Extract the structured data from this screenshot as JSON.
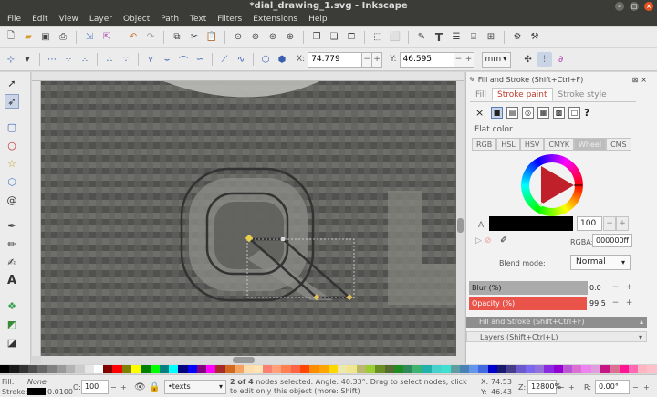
{
  "window": {
    "title": "*dial_drawing_1.svg - Inkscape"
  },
  "menu": [
    "File",
    "Edit",
    "View",
    "Layer",
    "Object",
    "Path",
    "Text",
    "Filters",
    "Extensions",
    "Help"
  ],
  "toolbar": {
    "x_label": "X:",
    "x_value": "74.779",
    "y_label": "Y:",
    "y_value": "46.595",
    "unit": "mm"
  },
  "fill_stroke": {
    "header": "Fill and Stroke (Shift+Ctrl+F)",
    "tabs": [
      "Fill",
      "Stroke paint",
      "Stroke style"
    ],
    "active_tab": "Stroke paint",
    "flat_color_label": "Flat color",
    "color_modes": [
      "RGB",
      "HSL",
      "HSV",
      "CMYK",
      "Wheel",
      "CMS"
    ],
    "active_mode": "Wheel",
    "alpha_label": "A:",
    "alpha_value": "100",
    "rgba_label": "RGBA:",
    "rgba_value": "000000ff",
    "blend_mode_label": "Blend mode:",
    "blend_mode_value": "Normal",
    "blur_label": "Blur (%)",
    "blur_value": "0.0",
    "opacity_label": "Opacity (%)",
    "opacity_value": "99.5",
    "opacity_level": 0.995,
    "collapsed_fill_stroke": "Fill and Stroke (Shift+Ctrl+F)",
    "collapsed_layers": "Layers (Shift+Ctrl+L)"
  },
  "status": {
    "fill_label": "Fill:",
    "fill_value": "None",
    "stroke_label": "Stroke:",
    "stroke_width": "0.0100",
    "opacity_label": "O:",
    "opacity_value": "100",
    "layer_value": "•texts",
    "message_bold": "2 of 4",
    "message": " nodes selected. Angle: 40.33°. Drag to select nodes, click to edit only this object (more: Shift)",
    "cursor_x_label": "X:",
    "cursor_x": "74.53",
    "cursor_y_label": "Y:",
    "cursor_y": "46.43",
    "zoom_label": "Z:",
    "zoom_value": "12800%",
    "rotation_label": "R:",
    "rotation_value": "0.00°"
  },
  "colors": {
    "accent_red": "#e9534a",
    "menubar_bg": "#3b3b37",
    "panel_bg": "#f2f2f2",
    "stroke_color": "#000000"
  },
  "icons": {
    "tools": [
      "selector-icon",
      "node-tool-icon",
      "rect-icon",
      "circle-icon",
      "star-icon",
      "3dbox-icon",
      "spiral-icon",
      "pen-icon",
      "pencil-icon",
      "calligraphy-icon",
      "text-icon",
      "spray-icon",
      "eraser-icon",
      "paint-bucket-icon",
      "gradient-icon",
      "dropper-icon"
    ]
  }
}
